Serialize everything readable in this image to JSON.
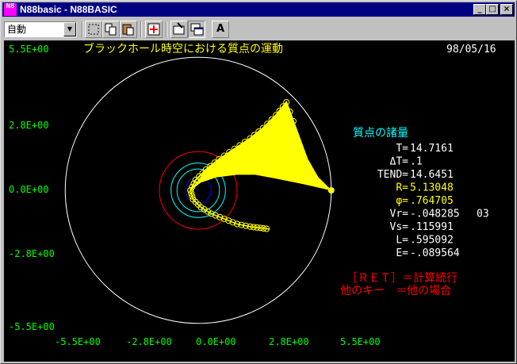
{
  "window": {
    "title": "N88basic - N88BASIC",
    "app_icon_text": "N8",
    "minimize_glyph": "_",
    "maximize_glyph": "□",
    "close_glyph": "×"
  },
  "toolbar": {
    "mode_value": "自動",
    "mode_arrow": "▼",
    "font_button_label": "A"
  },
  "screen": {
    "title": "ブラックホール時空における質点の運動",
    "date": "98/05/16",
    "colors": {
      "axis_text": "#00ff00",
      "title": "#ffff00",
      "panel_heading": "#00ffff",
      "orbit": "#ffff00",
      "horizon_outer": "#ff0000",
      "horizon_inner": "#0000ff",
      "photon": "#00ffff",
      "boundary": "#ffffff",
      "prompt": "#ff0000"
    },
    "panel": {
      "heading": "質点の諸量",
      "rows": [
        {
          "label": "T=",
          "value": "14.7161",
          "extra": "",
          "color": "#ffffff"
        },
        {
          "label": "ΔT=",
          "value": ".1",
          "extra": "",
          "color": "#ffffff"
        },
        {
          "label": "TEND=",
          "value": "14.6451",
          "extra": "",
          "color": "#ffffff"
        },
        {
          "label": "R=",
          "value": "5.13048",
          "extra": "",
          "color": "#ffff00"
        },
        {
          "label": "φ=",
          "value": ".764705",
          "extra": "",
          "color": "#ffff00"
        },
        {
          "label": "Vr=",
          "value": "-.048285",
          "extra": "03",
          "color": "#ffffff"
        },
        {
          "label": "Vs=",
          "value": ".115991",
          "extra": "",
          "color": "#ffffff"
        },
        {
          "label": "L=",
          "value": ".595092",
          "extra": "",
          "color": "#ffffff"
        },
        {
          "label": "E=",
          "value": "-.089564",
          "extra": "",
          "color": "#ffffff"
        }
      ]
    },
    "prompt_line1": "［ＲＥＴ］＝計算続行",
    "prompt_line2": "他のキー　＝他の場合"
  },
  "chart_data": {
    "type": "scatter",
    "title": "ブラックホール時空における質点の運動",
    "xlim": [
      -5.5,
      5.5
    ],
    "ylim": [
      -5.5,
      5.5
    ],
    "x_ticks": [
      "-5.5E+00",
      "-2.8E+00",
      "0.0E+00",
      "2.8E+00",
      "5.5E+00"
    ],
    "y_ticks": [
      "5.5E+00",
      "2.8E+00",
      "0.0E+00",
      "-2.8E+00",
      "-5.5E+00"
    ],
    "tick_values": [
      -5.5,
      -2.75,
      0,
      2.75,
      5.5
    ],
    "circles": [
      {
        "name": "boundary",
        "r": 5.13,
        "color": "#ffffff"
      },
      {
        "name": "outer-horizon",
        "r": 1.5,
        "color": "#ff0000"
      },
      {
        "name": "photon-sphere",
        "r": 1.05,
        "color": "#00ffff"
      },
      {
        "name": "photon-sphere-inner",
        "r": 0.82,
        "color": "#00ffff"
      },
      {
        "name": "inner-horizon",
        "r": 0.5,
        "color": "#0000ff"
      }
    ],
    "orbit_arc": [
      [
        -0.3,
        0.0
      ],
      [
        -0.1,
        0.4
      ],
      [
        0.3,
        0.8
      ],
      [
        0.8,
        1.2
      ],
      [
        1.4,
        1.6
      ],
      [
        2.0,
        2.0
      ],
      [
        2.5,
        2.4
      ],
      [
        3.0,
        2.9
      ],
      [
        3.4,
        3.4
      ],
      [
        3.8,
        2.3
      ],
      [
        4.2,
        1.2
      ],
      [
        4.6,
        0.5
      ],
      [
        5.1,
        0.0
      ]
    ],
    "orbit_tail": [
      [
        -0.3,
        0.0
      ],
      [
        -0.2,
        -0.35
      ],
      [
        0.1,
        -0.65
      ],
      [
        0.5,
        -0.9
      ],
      [
        1.0,
        -1.1
      ],
      [
        1.5,
        -1.3
      ],
      [
        2.0,
        -1.4
      ],
      [
        2.4,
        -1.45
      ],
      [
        2.75,
        -1.5
      ]
    ],
    "fill_region": [
      [
        3.4,
        3.4
      ],
      [
        3.8,
        2.3
      ],
      [
        4.2,
        1.2
      ],
      [
        4.6,
        0.5
      ],
      [
        5.1,
        0.0
      ],
      [
        4.0,
        0.25
      ],
      [
        3.0,
        0.45
      ],
      [
        2.2,
        0.6
      ],
      [
        1.5,
        0.6
      ],
      [
        0.7,
        0.5
      ],
      [
        0.1,
        0.3
      ],
      [
        -0.3,
        0.0
      ],
      [
        0.3,
        0.8
      ],
      [
        0.8,
        1.2
      ],
      [
        1.4,
        1.6
      ],
      [
        2.0,
        2.0
      ],
      [
        2.5,
        2.4
      ],
      [
        3.0,
        2.9
      ]
    ],
    "current_position": [
      5.13,
      0.0
    ]
  }
}
